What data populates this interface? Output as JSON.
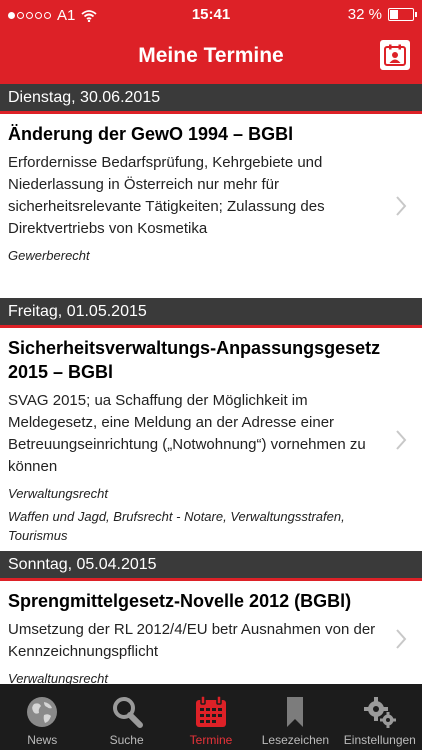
{
  "status": {
    "carrier": "A1",
    "time": "15:41",
    "battery": "32 %",
    "battery_level": 0.32
  },
  "header": {
    "title": "Meine Termine",
    "calendar_icon": "calendar-person-icon"
  },
  "groups": [
    {
      "date": "Dienstag, 30.06.2015",
      "entries": [
        {
          "title": "Änderung der GewO 1994 – BGBl",
          "description": "Erfordernisse Bedarfsprüfung, Kehrgebiete und Niederlassung in Österreich nur mehr für sicherheitsrelevante Tätigkeiten; Zulassung des Direktvertriebs von Kosmetika",
          "category": "Gewerberecht",
          "subcategories": ""
        }
      ]
    },
    {
      "date": "Freitag, 01.05.2015",
      "entries": [
        {
          "title": "Sicherheitsverwaltungs-Anpassungsgesetz 2015 – BGBl",
          "description": "SVAG 2015; ua Schaffung der Möglichkeit im Meldegesetz, eine Meldung an der Adresse einer Betreuungseinrichtung („Notwohnung“) vornehmen zu können",
          "category": "Verwaltungsrecht",
          "subcategories": "Waffen und Jagd, Brufsrecht - Notare, Verwaltungsstrafen, Tourismus"
        }
      ]
    },
    {
      "date": "Sonntag, 05.04.2015",
      "entries": [
        {
          "title": "Sprengmittelgesetz-Novelle 2012 (BGBl)",
          "description": "Umsetzung der RL 2012/4/EU betr Ausnahmen von der Kennzeichnungspflicht",
          "category": "Verwaltungsrecht",
          "subcategories": ""
        }
      ]
    }
  ],
  "tabs": [
    {
      "label": "News",
      "icon": "globe-icon"
    },
    {
      "label": "Suche",
      "icon": "search-icon"
    },
    {
      "label": "Termine",
      "icon": "calendar-icon"
    },
    {
      "label": "Lesezeichen",
      "icon": "bookmark-icon"
    },
    {
      "label": "Einstellungen",
      "icon": "gears-icon"
    }
  ],
  "active_tab": "Termine",
  "colors": {
    "accent": "#dd2127",
    "date_header_bg": "#3a3a3a",
    "tabbar_bg": "#1c1c1c",
    "tab_active": "#e8333a"
  }
}
